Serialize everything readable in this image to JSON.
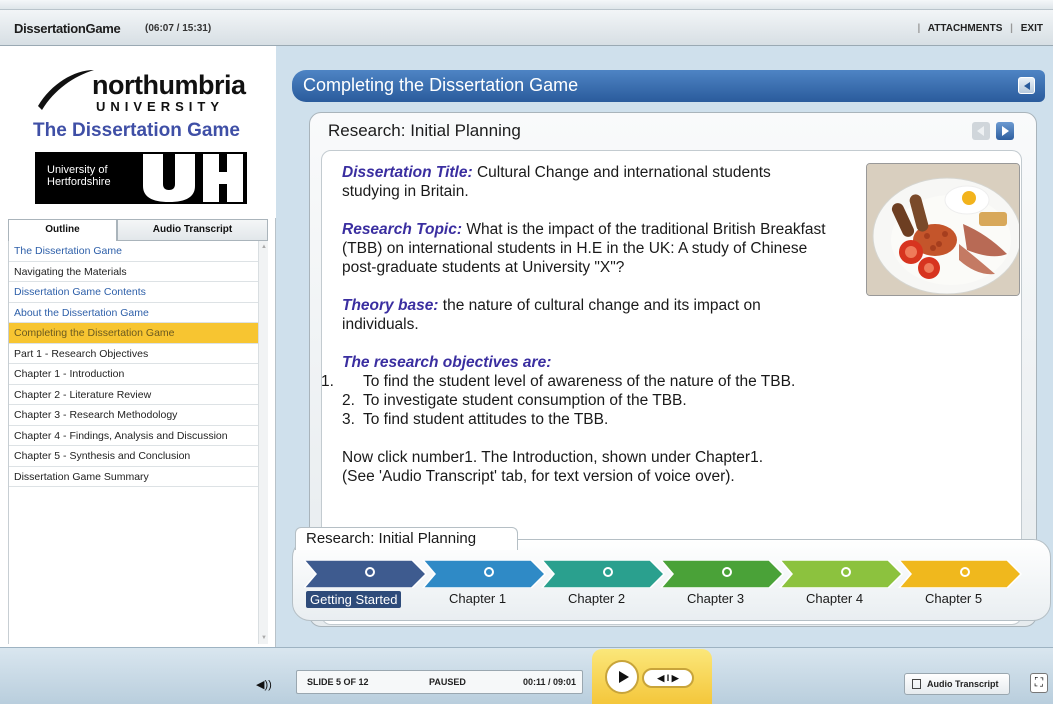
{
  "header": {
    "app_title": "DissertationGame",
    "time": "(06:07 / 15:31)",
    "attachments": "ATTACHMENTS",
    "exit": "EXIT"
  },
  "sidebar": {
    "university_name": "northumbria",
    "university_word": "UNIVERSITY",
    "game_title": "The Dissertation Game",
    "partner_line1": "University of",
    "partner_line2": "Hertfordshire",
    "tabs": [
      "Outline",
      "Audio Transcript"
    ],
    "items": [
      {
        "label": "The Dissertation Game",
        "style": "link"
      },
      {
        "label": "Navigating the Materials",
        "style": "normal"
      },
      {
        "label": "Dissertation Game Contents",
        "style": "link"
      },
      {
        "label": "About the Dissertation Game",
        "style": "link"
      },
      {
        "label": "Completing the Dissertation Game",
        "style": "active"
      },
      {
        "label": "Part 1 - Research Objectives",
        "style": "normal"
      },
      {
        "label": "Chapter 1 - Introduction",
        "style": "normal"
      },
      {
        "label": "Chapter 2 - Literature Review",
        "style": "normal"
      },
      {
        "label": "Chapter 3 - Research Methodology",
        "style": "normal"
      },
      {
        "label": "Chapter 4 - Findings, Analysis and Discussion",
        "style": "normal"
      },
      {
        "label": "Chapter 5 - Synthesis and Conclusion",
        "style": "normal"
      },
      {
        "label": "Dissertation Game Summary",
        "style": "normal"
      }
    ]
  },
  "main": {
    "module_title": "Completing the Dissertation Game",
    "slide_title": "Research: Initial Planning",
    "diss_title_label": "Dissertation Title:",
    "diss_title_text": "Cultural Change and international students studying in Britain.",
    "topic_label": "Research Topic:",
    "topic_text": "What is the impact of the traditional British Breakfast (TBB) on international students in H.E in the UK: A study of Chinese post-graduate students at University \"X\"?",
    "theory_label": "Theory base:",
    "theory_text": "the nature of cultural change and its impact on individuals.",
    "objectives_label": "The research objectives are:",
    "objectives": [
      {
        "num": "1.",
        "text": "To find the student level of awareness of the nature of the TBB."
      },
      {
        "num": "2.",
        "text": "To investigate student consumption of the TBB."
      },
      {
        "num": "3.",
        "text": "To find student attitudes to the TBB."
      }
    ],
    "instruction_line1": "Now click number1. The Introduction, shown under Chapter1.",
    "instruction_line2": "(See 'Audio Transcript' tab, for text version of voice over)."
  },
  "progress": {
    "label": "Research: Initial Planning",
    "steps": [
      {
        "label": "Getting Started",
        "color": "#3e5b8f",
        "current": true
      },
      {
        "label": "Chapter 1",
        "color": "#2f8ac6",
        "current": false
      },
      {
        "label": "Chapter 2",
        "color": "#2aa08e",
        "current": false
      },
      {
        "label": "Chapter 3",
        "color": "#4aa238",
        "current": false
      },
      {
        "label": "Chapter 4",
        "color": "#8cc23e",
        "current": false
      },
      {
        "label": "Chapter 5",
        "color": "#f0b81d",
        "current": false
      }
    ]
  },
  "toolbar": {
    "slide_counter": "SLIDE 5 OF 12",
    "status": "PAUSED",
    "time": "00:11 / 09:01",
    "transcript_button": "Audio Transcript"
  },
  "colors": {
    "accent_blue": "#2a5b9c",
    "highlight_yellow": "#f7c531",
    "label_purple": "#3a2ea0"
  }
}
